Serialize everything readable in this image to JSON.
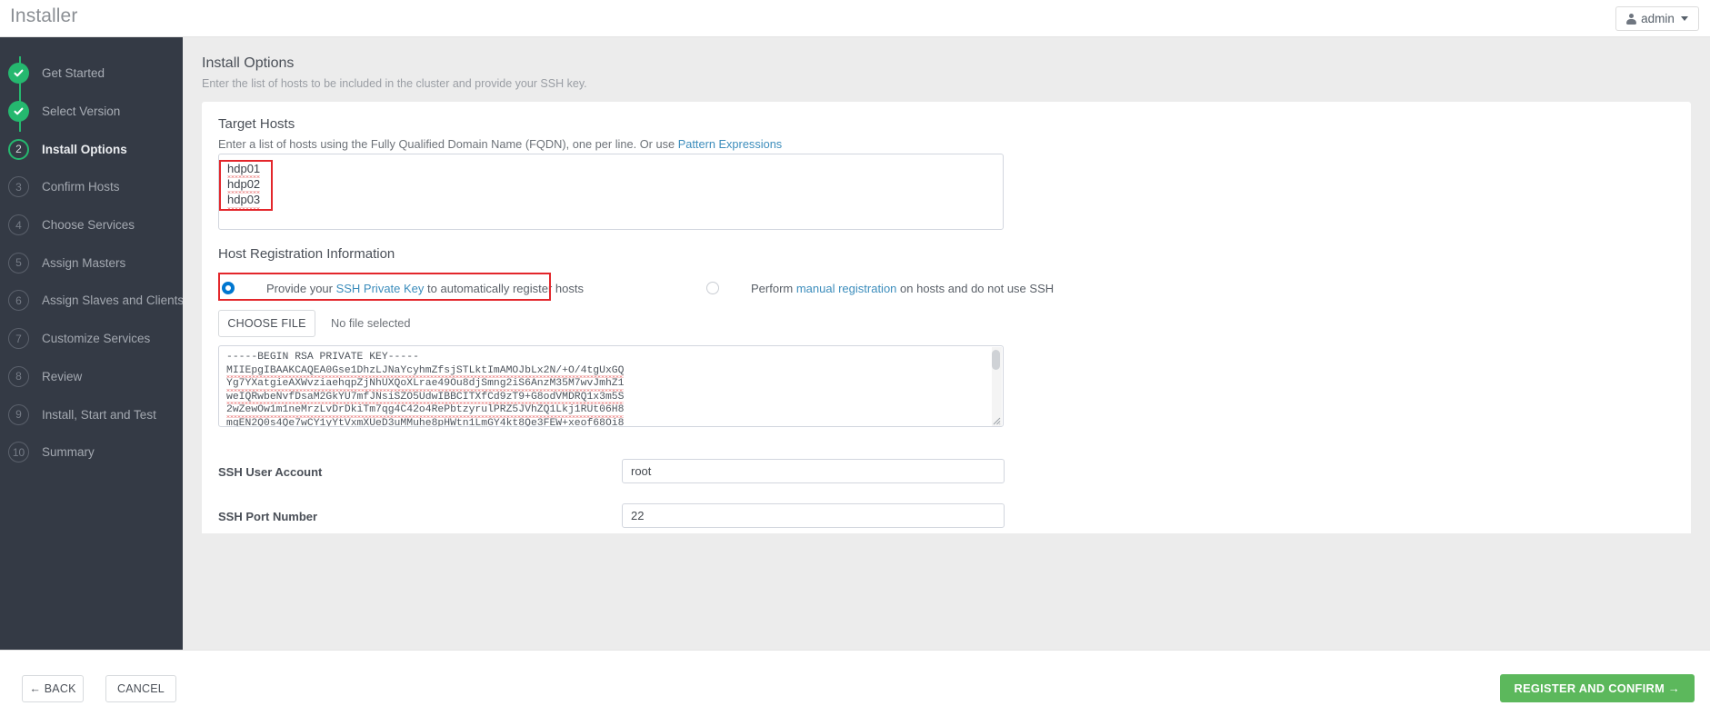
{
  "header": {
    "brand": "Installer",
    "user_label": "admin",
    "user_icon": "user-icon",
    "caret_icon": "chevron-down-icon"
  },
  "sidebar": {
    "steps": [
      {
        "num": "✓",
        "label": "Get Started",
        "state": "done"
      },
      {
        "num": "✓",
        "label": "Select Version",
        "state": "done"
      },
      {
        "num": "2",
        "label": "Install Options",
        "state": "current"
      },
      {
        "num": "3",
        "label": "Confirm Hosts",
        "state": "todo"
      },
      {
        "num": "4",
        "label": "Choose Services",
        "state": "todo"
      },
      {
        "num": "5",
        "label": "Assign Masters",
        "state": "todo"
      },
      {
        "num": "6",
        "label": "Assign Slaves and Clients",
        "state": "todo"
      },
      {
        "num": "7",
        "label": "Customize Services",
        "state": "todo"
      },
      {
        "num": "8",
        "label": "Review",
        "state": "todo"
      },
      {
        "num": "9",
        "label": "Install, Start and Test",
        "state": "todo"
      },
      {
        "num": "10",
        "label": "Summary",
        "state": "todo"
      }
    ]
  },
  "main": {
    "title": "Install Options",
    "subtitle": "Enter the list of hosts to be included in the cluster and provide your SSH key.",
    "target_hosts": {
      "title": "Target Hosts",
      "desc_before": "Enter a list of hosts using the Fully Qualified Domain Name (FQDN), one per line. Or use ",
      "desc_link": "Pattern Expressions",
      "value_lines": [
        "hdp01",
        "hdp02",
        "hdp03"
      ],
      "value": "hdp01\nhdp02\nhdp03"
    },
    "host_registration": {
      "title": "Host Registration Information",
      "option_ssh": {
        "before": "Provide your ",
        "link": "SSH Private Key",
        "after": " to automatically register hosts",
        "selected": true
      },
      "option_manual": {
        "before": "Perform ",
        "link": "manual registration",
        "after": " on hosts and do not use SSH",
        "selected": false
      },
      "choose_file_label": "CHOOSE FILE",
      "no_file_text": "No file selected",
      "private_key_lines": [
        "-----BEGIN RSA PRIVATE KEY-----",
        "MIIEpgIBAAKCAQEA0Gse1DhzLJNaYcyhmZfsjSTLktImAMOJbLx2N/+O/4tgUxGQ",
        "Yg7YXatgieAXWvziaehqpZjNhUXQoXLrae49Ou8djSmng2iS6AnzM35M7wvJmhZ1",
        "weIQRwbeNvfDsaM2GkYU7mfJNsiSZO5UdwIBBCITXfCd9zT9+G8odVMDRQ1x3m5S",
        "2wZewOw1m1neMrzLvDrDkiTm7qg4C42o4RePbtzyrulPRZ5JVhZQ1Lkj1RUt06H8",
        "mgEN2Q0s4Qe7wCY1yYtVxmXUeD3uMMuhe8pHWtn1LmGY4kt8Qe3FEW+xeof68Oi8"
      ]
    },
    "ssh_user": {
      "label": "SSH User Account",
      "value": "root"
    },
    "ssh_port": {
      "label": "SSH Port Number",
      "value": "22"
    }
  },
  "footer": {
    "back_label": "← BACK",
    "cancel_label": "CANCEL",
    "submit_label": "REGISTER AND CONFIRM →"
  },
  "colors": {
    "sidebar_bg": "#343a45",
    "accent_green": "#25b86f",
    "link_blue": "#3c8dbc",
    "radio_blue": "#0077d0",
    "highlight_red": "#e3262b",
    "submit_green": "#5cb85c"
  }
}
